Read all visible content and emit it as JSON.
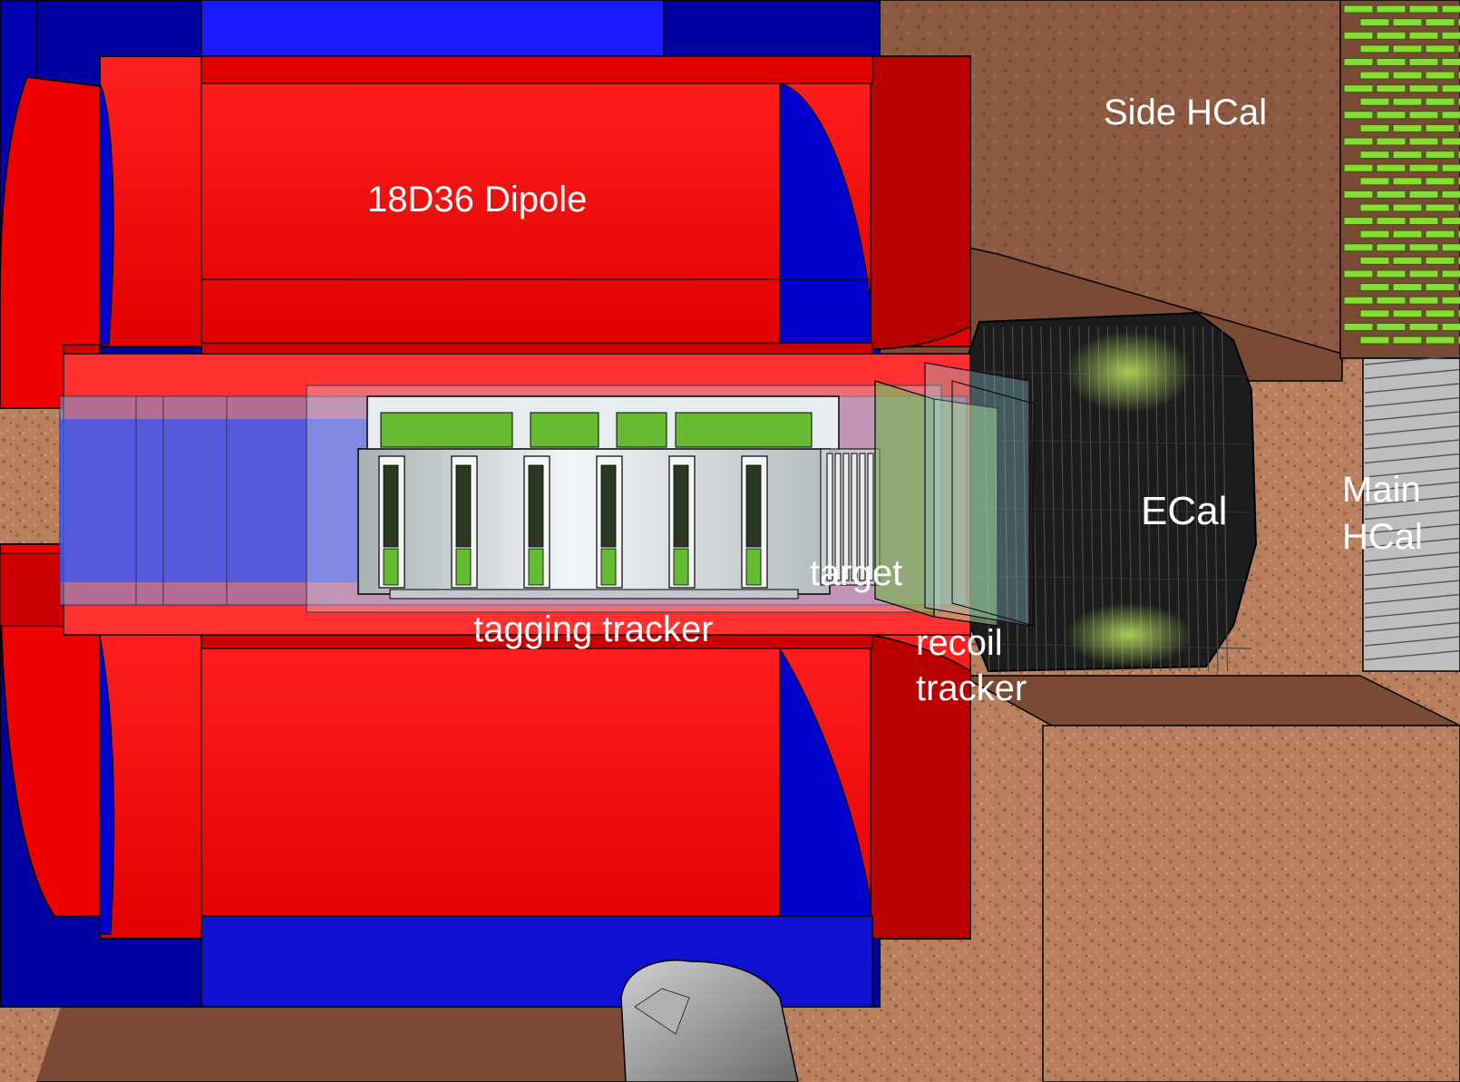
{
  "labels": {
    "dipole": "18D36 Dipole",
    "side_hcal": "Side HCal",
    "ecal": "ECal",
    "main_hcal_line1": "Main",
    "main_hcal_line2": "HCal",
    "target": "target",
    "tagging_tracker": "tagging tracker",
    "recoil_tracker_line1": "recoil",
    "recoil_tracker_line2": "tracker"
  },
  "colors": {
    "magnet_red": "#ff1a1a",
    "magnet_dark_red": "#b00000",
    "yoke_blue": "#1010cc",
    "yoke_dark_blue": "#000088",
    "concrete": "#9a6a4c",
    "scintillator_green": "#88dd33",
    "module_green": "#66bb33",
    "tracker_silver": "#d4dadc"
  }
}
